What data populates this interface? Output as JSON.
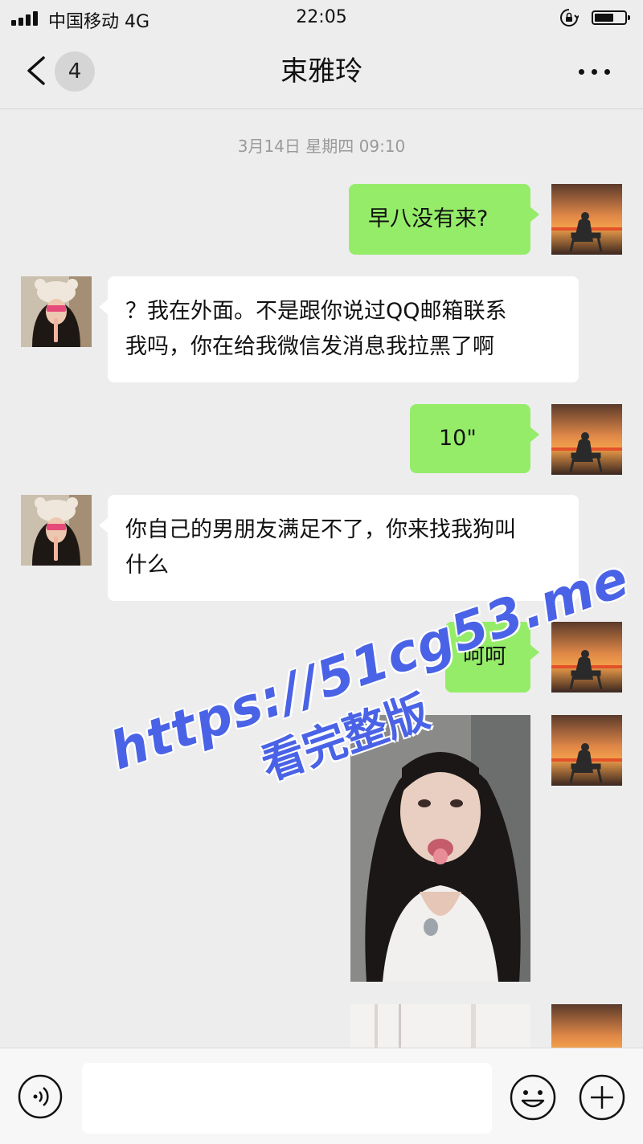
{
  "status_bar": {
    "carrier": "中国移动 4G",
    "time": "22:05",
    "battery_level": 0.58
  },
  "nav": {
    "back_icon": "chevron-left-icon",
    "unread_count": "4",
    "title": "束雅玲",
    "more_icon": "more-dots-icon"
  },
  "chat": {
    "timestamp": "3月14日 星期四 09:10",
    "messages": [
      {
        "sender": "me",
        "type": "text",
        "text": "早八没有来?"
      },
      {
        "sender": "them",
        "type": "text",
        "lines": [
          "？我在外面。不是跟你说过QQ邮箱联系",
          "我吗，你在给我微信发消息我拉黑了啊"
        ]
      },
      {
        "sender": "me",
        "type": "text",
        "text": "10\""
      },
      {
        "sender": "them",
        "type": "text",
        "lines": [
          "你自己的男朋友满足不了，你来找我狗叫",
          "什么"
        ]
      },
      {
        "sender": "me",
        "type": "text",
        "text": "呵呵"
      },
      {
        "sender": "me",
        "type": "image"
      },
      {
        "sender": "me",
        "type": "image"
      }
    ]
  },
  "watermark": {
    "url": "https://51cg53.me",
    "subtitle": "看完整版"
  },
  "input_bar": {
    "voice_icon": "voice-icon",
    "emoji_icon": "emoji-icon",
    "plus_icon": "plus-icon",
    "value": ""
  },
  "colors": {
    "background": "#ededed",
    "my_bubble": "#95ec69",
    "their_bubble": "#ffffff",
    "watermark": "#4a63e6"
  }
}
